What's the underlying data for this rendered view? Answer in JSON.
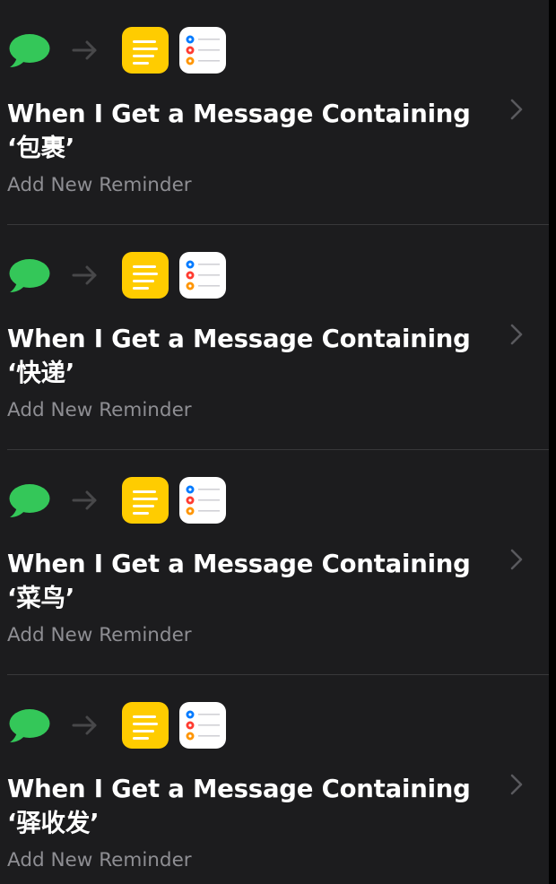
{
  "shortcuts": [
    {
      "title": "When I Get a Message Containing ‘包裹’",
      "subtitle": "Add New Reminder"
    },
    {
      "title": "When I Get a Message Containing ‘快递’",
      "subtitle": "Add New Reminder"
    },
    {
      "title": "When I Get a Message Containing ‘菜鸟’",
      "subtitle": "Add New Reminder"
    },
    {
      "title": "When I Get a Message Containing ‘驿收发’",
      "subtitle": "Add New Reminder"
    }
  ],
  "icons": {
    "trigger": "messages-icon",
    "arrow": "arrow-right-icon",
    "action_1": "notes-icon",
    "action_2": "reminders-icon",
    "disclosure": "chevron-right-icon"
  },
  "colors": {
    "background": "#1c1c1e",
    "messages_green": "#34c759",
    "notes_yellow": "#ffcc00",
    "title_text": "#ffffff",
    "subtitle_text": "#8e8e93",
    "divider": "#38383a",
    "chevron": "#5a5a5e"
  }
}
